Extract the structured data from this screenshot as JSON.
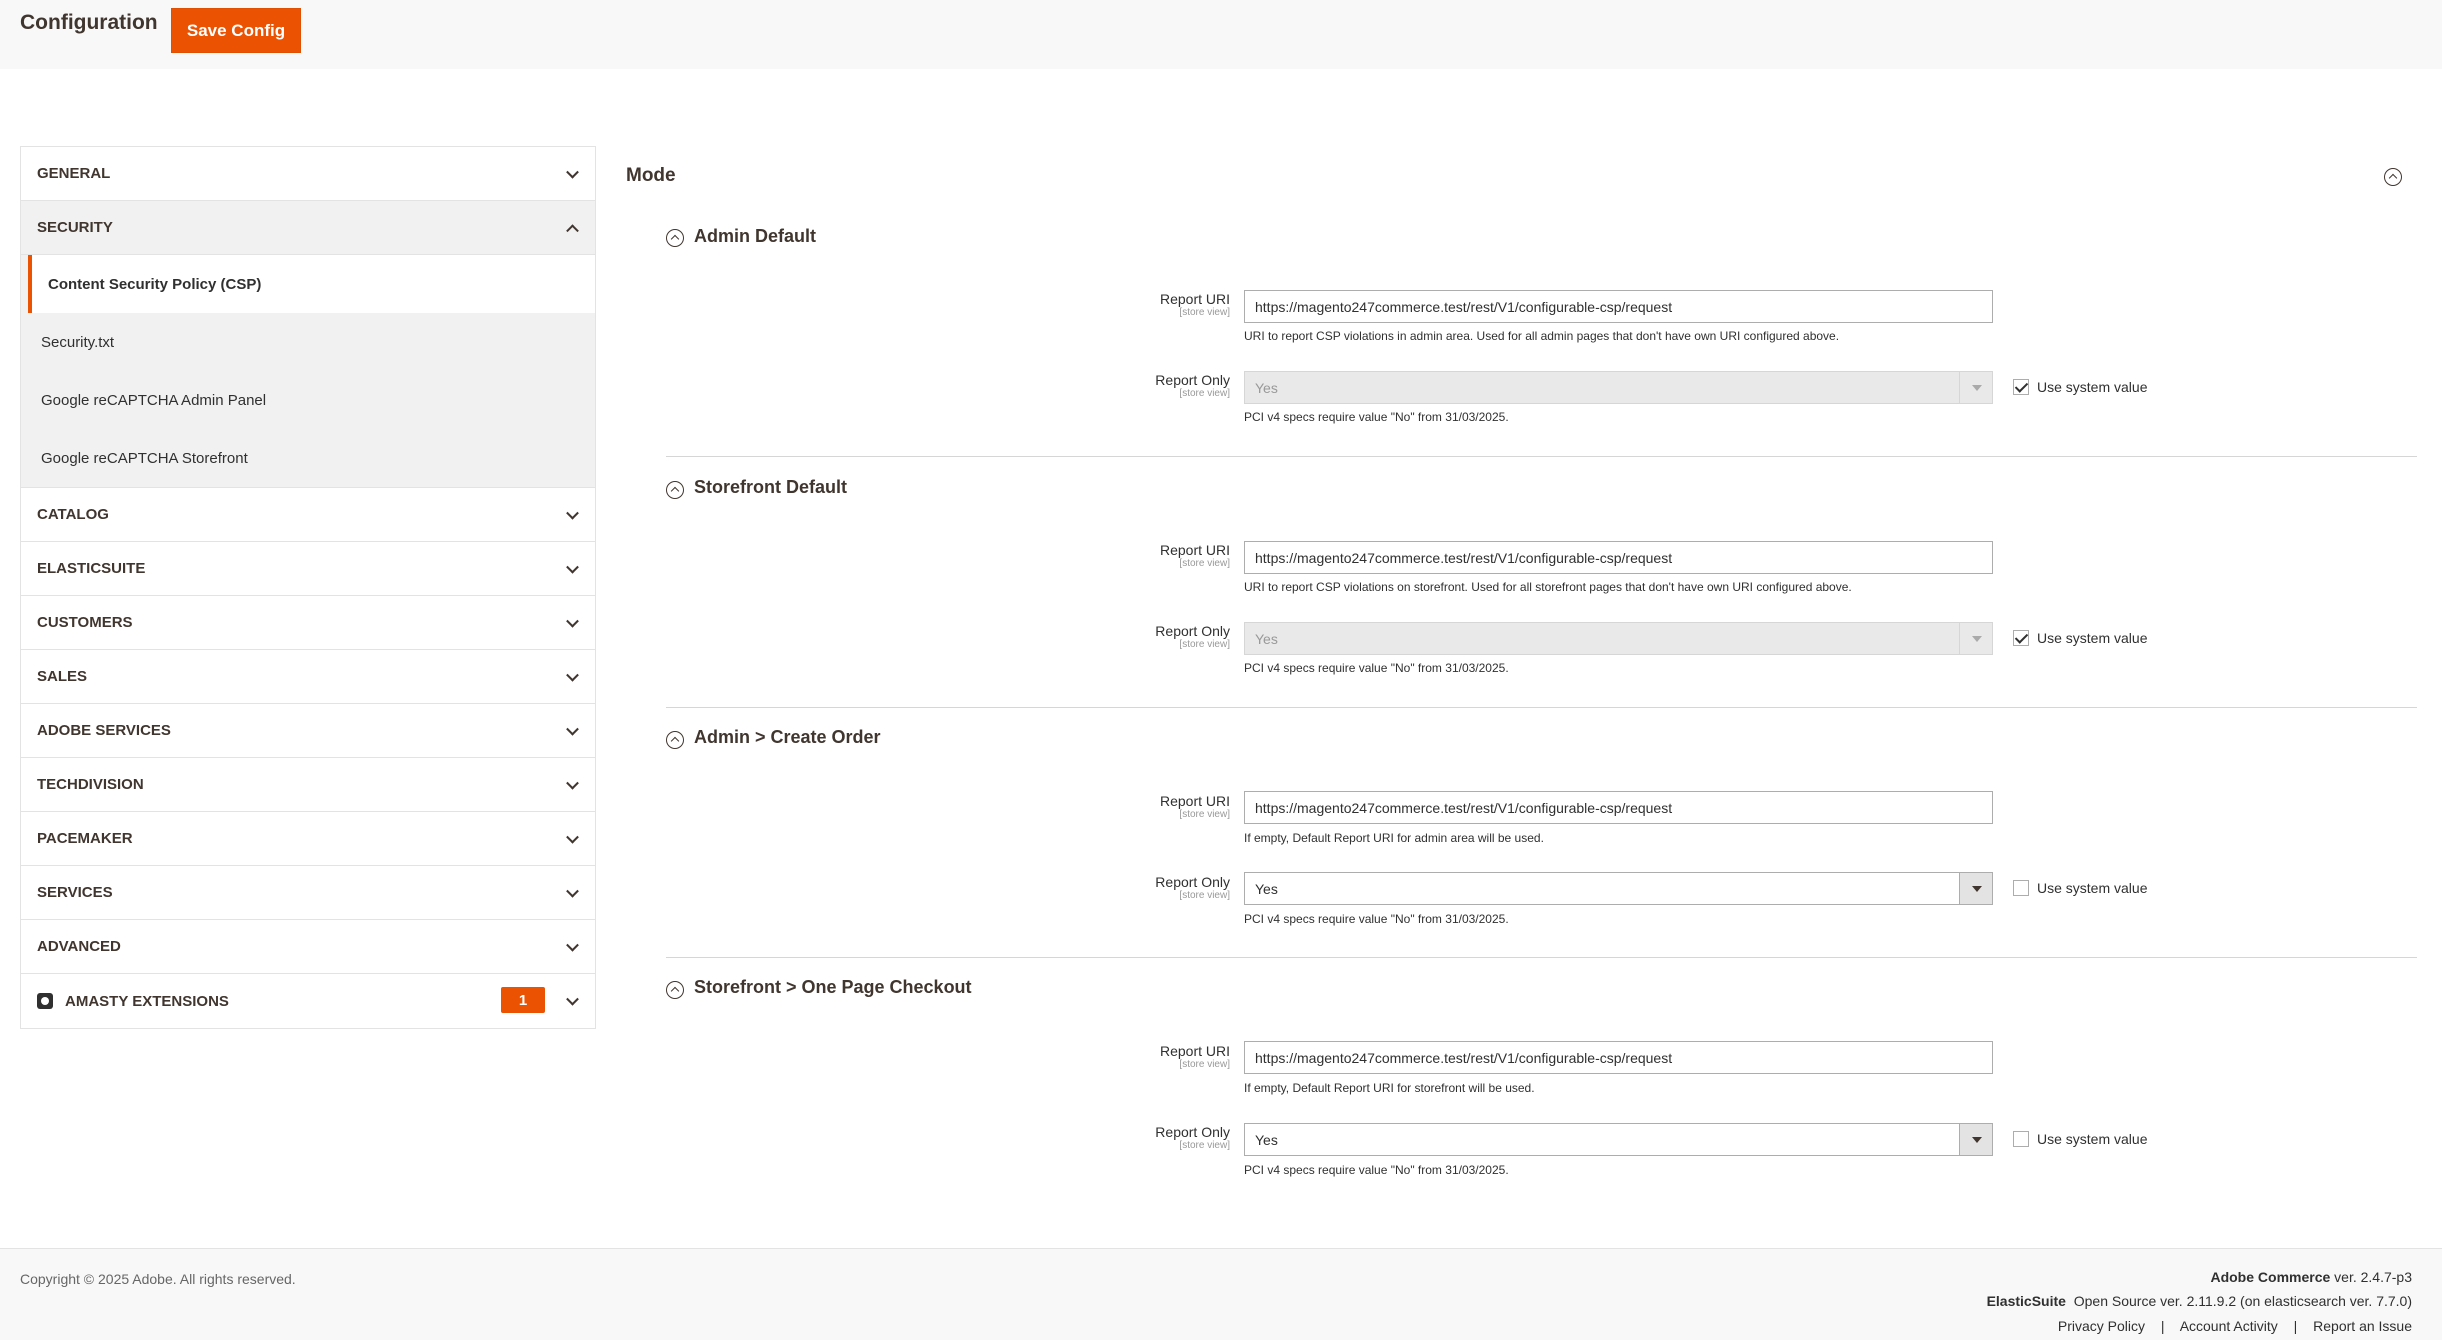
{
  "header": {
    "title": "Configuration",
    "save_label": "Save Config"
  },
  "sidebar": {
    "sections": [
      {
        "label": "GENERAL"
      },
      {
        "label": "SECURITY"
      },
      {
        "label": "CATALOG"
      },
      {
        "label": "ELASTICSUITE"
      },
      {
        "label": "CUSTOMERS"
      },
      {
        "label": "SALES"
      },
      {
        "label": "ADOBE SERVICES"
      },
      {
        "label": "TECHDIVISION"
      },
      {
        "label": "PACEMAKER"
      },
      {
        "label": "SERVICES"
      },
      {
        "label": "ADVANCED"
      },
      {
        "label": "AMASTY EXTENSIONS",
        "badge": "1"
      }
    ],
    "security_items": [
      {
        "label": "Content Security Policy (CSP)"
      },
      {
        "label": "Security.txt"
      },
      {
        "label": "Google reCAPTCHA Admin Panel"
      },
      {
        "label": "Google reCAPTCHA Storefront"
      }
    ]
  },
  "main": {
    "mode_title": "Mode",
    "groups": [
      {
        "title": "Admin Default",
        "report_uri_label": "Report URI",
        "report_uri_scope": "[store view]",
        "report_uri_value": "https://magento247commerce.test/rest/V1/configurable-csp/request",
        "report_uri_note": "URI to report CSP violations in admin area. Used for all admin pages that don't have own URI configured above.",
        "report_only_label": "Report Only",
        "report_only_scope": "[store view]",
        "report_only_value": "Yes",
        "report_only_note": "PCI v4 specs require value \"No\" from 31/03/2025.",
        "use_system_label": "Use system value",
        "use_system_checked": true
      },
      {
        "title": "Storefront Default",
        "report_uri_label": "Report URI",
        "report_uri_scope": "[store view]",
        "report_uri_value": "https://magento247commerce.test/rest/V1/configurable-csp/request",
        "report_uri_note": "URI to report CSP violations on storefront. Used for all storefront pages that don't have own URI configured above.",
        "report_only_label": "Report Only",
        "report_only_scope": "[store view]",
        "report_only_value": "Yes",
        "report_only_note": "PCI v4 specs require value \"No\" from 31/03/2025.",
        "use_system_label": "Use system value",
        "use_system_checked": true
      },
      {
        "title": "Admin > Create Order",
        "report_uri_label": "Report URI",
        "report_uri_scope": "[store view]",
        "report_uri_value": "https://magento247commerce.test/rest/V1/configurable-csp/request",
        "report_uri_note": "If empty, Default Report URI for admin area will be used.",
        "report_only_label": "Report Only",
        "report_only_scope": "[store view]",
        "report_only_value": "Yes",
        "report_only_note": "PCI v4 specs require value \"No\" from 31/03/2025.",
        "use_system_label": "Use system value",
        "use_system_checked": false
      },
      {
        "title": "Storefront > One Page Checkout",
        "report_uri_label": "Report URI",
        "report_uri_scope": "[store view]",
        "report_uri_value": "https://magento247commerce.test/rest/V1/configurable-csp/request",
        "report_uri_note": "If empty, Default Report URI for storefront will be used.",
        "report_only_label": "Report Only",
        "report_only_scope": "[store view]",
        "report_only_value": "Yes",
        "report_only_note": "PCI v4 specs require value \"No\" from 31/03/2025.",
        "use_system_label": "Use system value",
        "use_system_checked": false
      }
    ]
  },
  "footer": {
    "copyright": "Copyright © 2025 Adobe. All rights reserved.",
    "product_name": "Adobe Commerce",
    "product_version": "ver. 2.4.7-p3",
    "es_name": "ElasticSuite",
    "es_version": "Open Source ver. 2.11.9.2 (on elasticsearch ver. 7.7.0)",
    "links": [
      "Privacy Policy",
      "Account Activity",
      "Report an Issue"
    ],
    "separator": "|"
  },
  "colors": {
    "accent": "#eb5202",
    "text": "#303030",
    "heading": "#41362f"
  }
}
